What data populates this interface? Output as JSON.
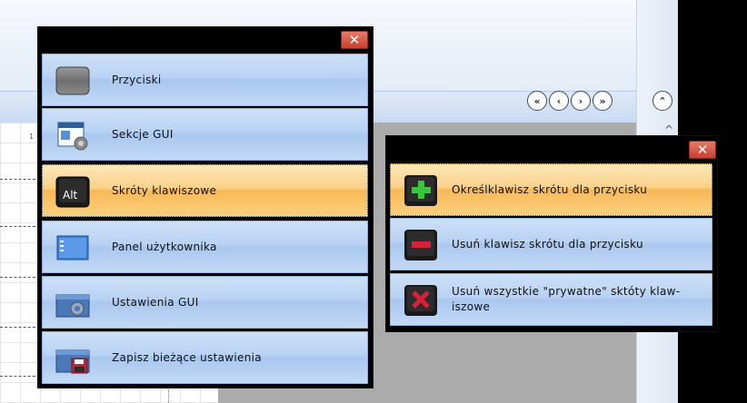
{
  "background": {
    "ruler_number": "1",
    "nav_buttons": [
      {
        "name": "first-page-button",
        "glyph": "«"
      },
      {
        "name": "prev-page-button",
        "glyph": "‹"
      },
      {
        "name": "next-page-button",
        "glyph": "›"
      },
      {
        "name": "last-page-button",
        "glyph": "»"
      }
    ],
    "collapse_glyph": "⌃",
    "scroll_caret": "^"
  },
  "main_menu": {
    "close_glyph": "✕",
    "items": [
      {
        "label": "Przyciski",
        "icon": "button-icon"
      },
      {
        "label": "Sekcje GUI",
        "icon": "gui-sections-icon"
      },
      {
        "label": "Skróty klawiszowe",
        "icon": "alt-key-icon",
        "icon_text": "Alt",
        "selected": true
      },
      {
        "label": "Panel użytkownika",
        "icon": "user-panel-icon"
      },
      {
        "label": "Ustawienia GUI",
        "icon": "gui-settings-icon"
      },
      {
        "label": "Zapisz bieżące ustawienia",
        "icon": "save-settings-icon"
      }
    ]
  },
  "sub_menu": {
    "close_glyph": "✕",
    "items": [
      {
        "label": "Określklawisz skrótu dla przycisku",
        "icon": "add-key-icon",
        "selected": true
      },
      {
        "label": "Usuń klawisz skrótu dla przycisku",
        "icon": "remove-key-icon"
      },
      {
        "label": "Usuń wszystkie \"prywatne\" sktóty klaw-iszowe",
        "icon": "delete-all-keys-icon"
      }
    ]
  },
  "colors": {
    "item_blue": "#b9d2f3",
    "item_selected": "#f8b955",
    "close_red": "#c9402c"
  }
}
